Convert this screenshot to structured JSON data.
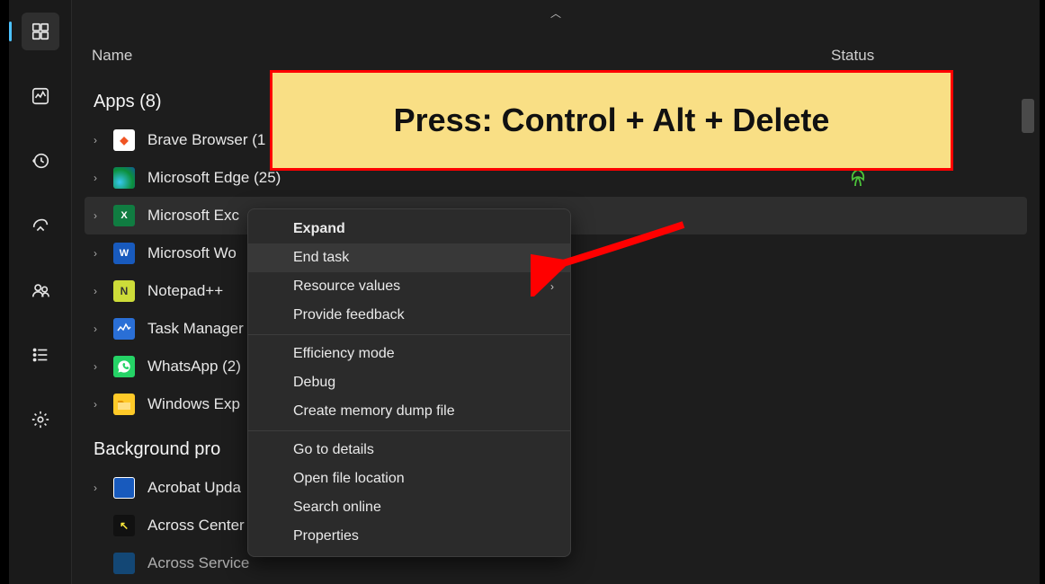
{
  "columns": {
    "name": "Name",
    "status": "Status"
  },
  "groups": {
    "apps": {
      "title": "Apps (8)"
    },
    "bg": {
      "title": "Background pro"
    }
  },
  "apps": [
    {
      "label": "Brave Browser (1",
      "leaf": true
    },
    {
      "label": "Microsoft Edge (25)",
      "leaf": true
    },
    {
      "label": "Microsoft Exc",
      "leaf": false,
      "selected": true
    },
    {
      "label": "Microsoft Wo",
      "leaf": false
    },
    {
      "label": "Notepad++",
      "leaf": false
    },
    {
      "label": "Task Manager",
      "leaf": false
    },
    {
      "label": "WhatsApp (2)",
      "leaf": false
    },
    {
      "label": "Windows Exp",
      "leaf": false
    }
  ],
  "bg_processes": [
    {
      "label": "Acrobat Upda"
    },
    {
      "label": "Across Center"
    },
    {
      "label": "Across Service"
    }
  ],
  "context_menu": {
    "expand": "Expand",
    "end_task": "End task",
    "resource_values": "Resource values",
    "provide_feedback": "Provide feedback",
    "efficiency_mode": "Efficiency mode",
    "debug": "Debug",
    "create_dump": "Create memory dump file",
    "go_to_details": "Go to details",
    "open_file_location": "Open file location",
    "search_online": "Search online",
    "properties": "Properties"
  },
  "annotation": {
    "text": "Press: Control + Alt + Delete"
  }
}
